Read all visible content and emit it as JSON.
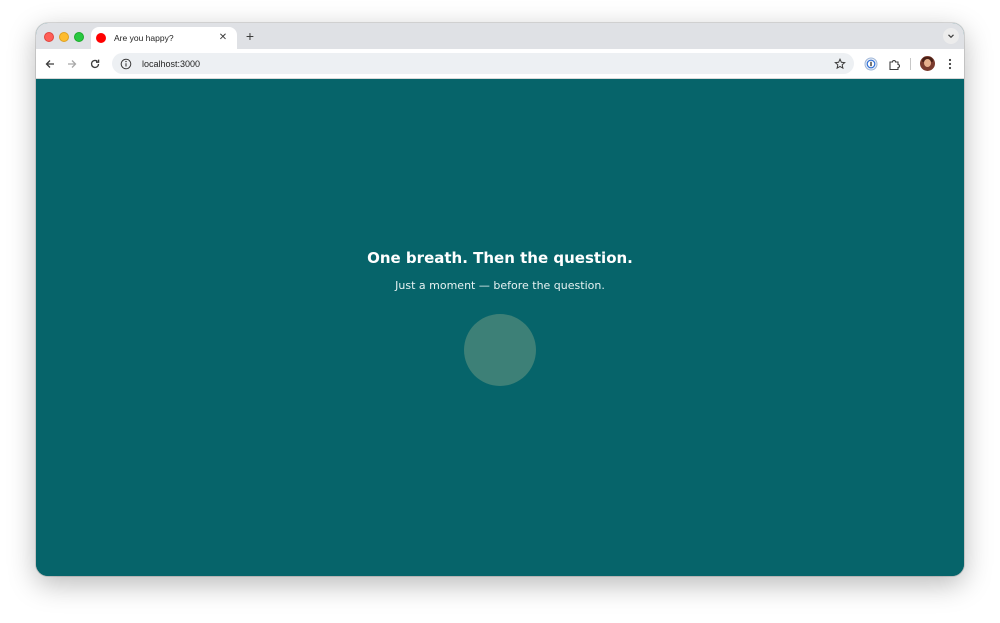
{
  "browser": {
    "tab": {
      "title": "Are you happy?",
      "favicon_color": "#ff0000"
    },
    "address_bar": {
      "url": "localhost:3000"
    }
  },
  "page": {
    "headline": "One breath. Then the question.",
    "subline": "Just a moment — before the question.",
    "background_color": "#06646a",
    "circle_color": "#3d8077"
  }
}
